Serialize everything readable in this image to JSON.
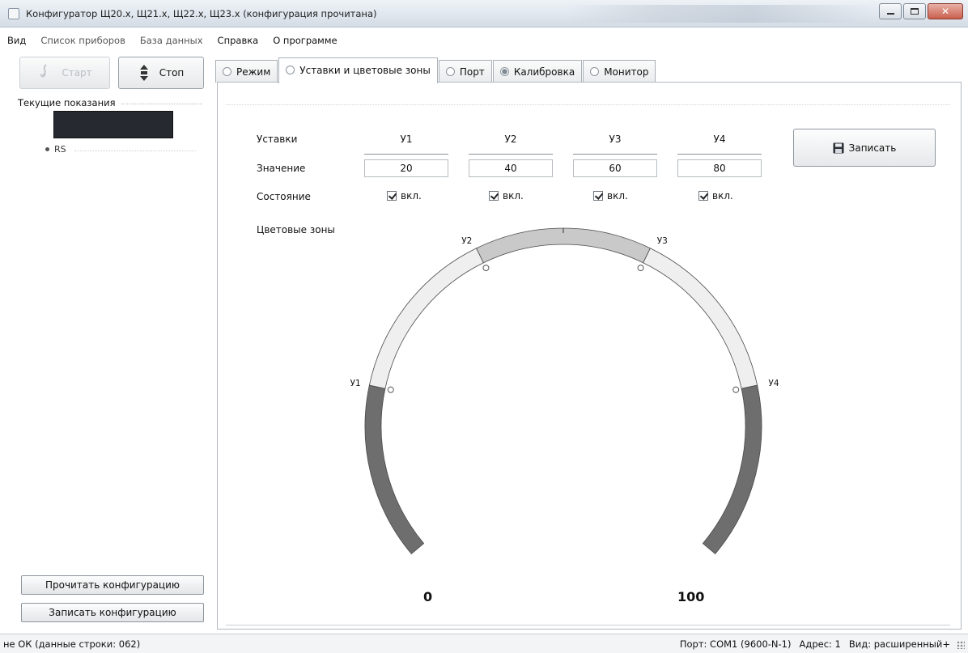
{
  "window": {
    "title": "Конфигуратор Щ20.х, Щ21.х, Щ22.х, Щ23.х (конфигурация прочитана)"
  },
  "menu": [
    "Вид",
    "Список приборов",
    "База данных",
    "Справка",
    "О программе"
  ],
  "toolbar": {
    "start_label": "Старт",
    "stop_label": "Стоп"
  },
  "left": {
    "current_title": "Текущие показания",
    "rs_label": "RS",
    "read_config": "Прочитать конфигурацию",
    "write_config": "Записать конфигурацию"
  },
  "tabs": [
    {
      "label": "Режим",
      "active": false
    },
    {
      "label": "Уставки и цветовые зоны",
      "active": true
    },
    {
      "label": "Порт",
      "active": false
    },
    {
      "label": "Калибровка",
      "active": false
    },
    {
      "label": "Монитор",
      "active": false
    }
  ],
  "setpoints": {
    "row_labels": {
      "setpoints": "Уставки",
      "value": "Значение",
      "state": "Состояние"
    },
    "columns": [
      {
        "name": "У1",
        "value": "20",
        "state_label": "вкл.",
        "checked": true
      },
      {
        "name": "У2",
        "value": "40",
        "state_label": "вкл.",
        "checked": true
      },
      {
        "name": "У3",
        "value": "60",
        "state_label": "вкл.",
        "checked": true
      },
      {
        "name": "У4",
        "value": "80",
        "state_label": "вкл.",
        "checked": true
      }
    ],
    "save_label": "Записать"
  },
  "zones": {
    "label": "Цветовые зоны",
    "min_label": "0",
    "max_label": "100",
    "marker_labels": [
      "У1",
      "У2",
      "У3",
      "У4"
    ],
    "colors": {
      "low": "#6e6e6e",
      "mid": "#efefef",
      "top": "#c9c9c9",
      "high": "#6e6e6e"
    }
  },
  "status": {
    "left": "не ОК (данные строки: 062)",
    "port": "Порт: COM1 (9600-N-1)",
    "address": "Адрес: 1",
    "view": "Вид: расширенный+"
  }
}
